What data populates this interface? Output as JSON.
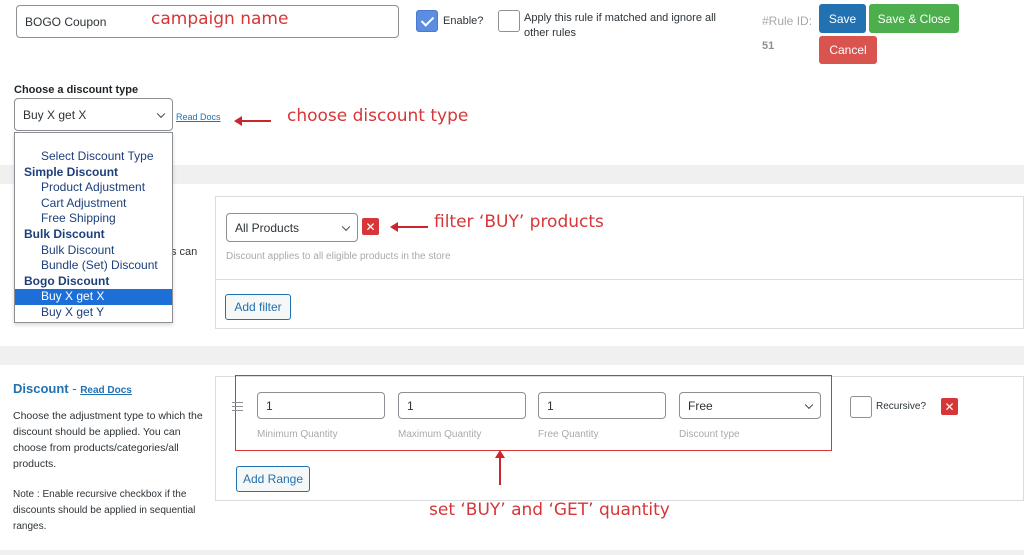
{
  "header": {
    "campaign_value": "BOGO Coupon",
    "enable_label": "Enable?",
    "ignore_rules_label": "Apply this rule if matched and ignore all other rules",
    "rule_id_label": "#Rule ID:",
    "rule_id_value": "51",
    "save_label": "Save",
    "save_close_label": "Save & Close",
    "cancel_label": "Cancel"
  },
  "discount_type": {
    "heading": "Choose a discount type",
    "selected": "Buy X get X",
    "read_docs": "Read Docs",
    "options": [
      {
        "label": "Select Discount Type",
        "group": false,
        "selected": false
      },
      {
        "label": "Simple Discount",
        "group": true,
        "selected": false
      },
      {
        "label": "Product Adjustment",
        "group": false,
        "selected": false
      },
      {
        "label": "Cart Adjustment",
        "group": false,
        "selected": false
      },
      {
        "label": "Free Shipping",
        "group": false,
        "selected": false
      },
      {
        "label": "Bulk Discount",
        "group": true,
        "selected": false
      },
      {
        "label": "Bulk Discount",
        "group": false,
        "selected": false
      },
      {
        "label": "Bundle (Set) Discount",
        "group": false,
        "selected": false
      },
      {
        "label": "Bogo Discount",
        "group": true,
        "selected": false
      },
      {
        "label": "Buy X get X",
        "group": false,
        "selected": true
      },
      {
        "label": "Buy X get Y",
        "group": false,
        "selected": false
      }
    ]
  },
  "filter": {
    "side_partial": "s can",
    "select_value": "All Products",
    "hint": "Discount applies to all eligible products in the store",
    "add_filter_label": "Add filter"
  },
  "discount": {
    "title": "Discount",
    "read_docs": "Read Docs",
    "description": "Choose the adjustment type to which the discount should be applied. You can choose from products/categories/all products.",
    "note": "Note : Enable recursive checkbox if the discounts should be applied in sequential ranges.",
    "min_qty": "1",
    "min_qty_label": "Minimum Quantity",
    "max_qty": "1",
    "max_qty_label": "Maximum Quantity",
    "free_qty": "1",
    "free_qty_label": "Free Quantity",
    "discount_type_value": "Free",
    "discount_type_label": "Discount type",
    "recursive_label": "Recursive?",
    "add_range_label": "Add Range"
  },
  "annotations": {
    "campaign": "campaign name",
    "discount_type": "choose discount type",
    "filter": "filter ‘BUY’ products",
    "quantity": "set ‘BUY’ and ‘GET’ quantity"
  },
  "colors": {
    "accent": "#2271b1",
    "save_close": "#4cae4c",
    "cancel": "#d9534f",
    "annotation": "#d63638"
  }
}
